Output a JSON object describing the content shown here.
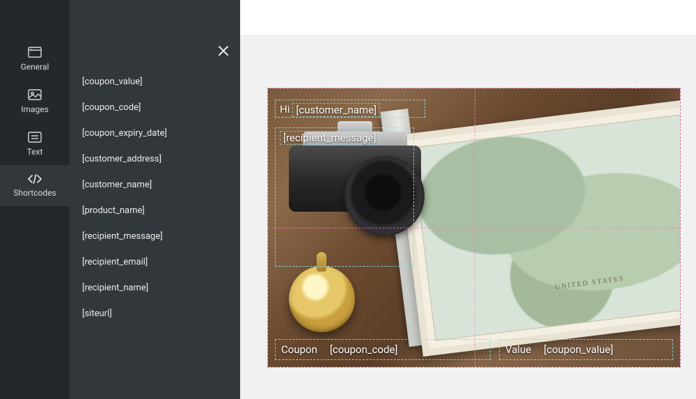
{
  "nav": {
    "items": [
      {
        "label": "General"
      },
      {
        "label": "Images"
      },
      {
        "label": "Text"
      },
      {
        "label": "Shortcodes"
      }
    ]
  },
  "shortcodes": [
    "[coupon_value]",
    "[coupon_code]",
    "[coupon_expiry_date]",
    "[customer_address]",
    "[customer_name]",
    "[product_name]",
    "[recipient_message]",
    "[recipient_email]",
    "[recipient_name]",
    "[siteurl]"
  ],
  "canvas": {
    "greeting_prefix": "Hi",
    "greeting_placeholder": "[customer_name]",
    "message_placeholder": "[recipient_message]",
    "coupon_label": "Coupon",
    "coupon_placeholder": "[coupon_code]",
    "value_label": "Value",
    "value_placeholder": "[coupon_value]",
    "map_label": "UNITED STATES"
  }
}
